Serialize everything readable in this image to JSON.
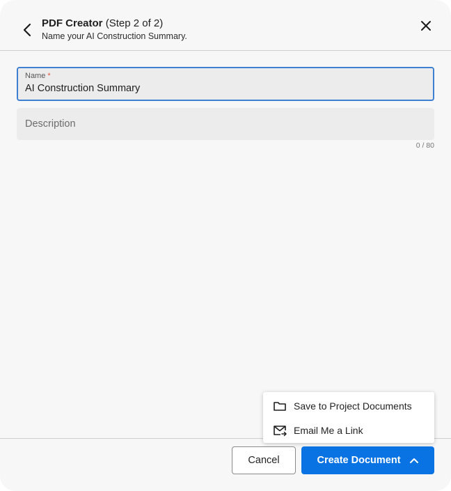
{
  "dialog": {
    "title": "PDF Creator",
    "step": "(Step 2 of 2)",
    "subtitle": "Name your AI Construction Summary."
  },
  "form": {
    "name_label": "Name",
    "required_marker": "*",
    "name_value": "AI Construction Summary",
    "description_placeholder": "Description",
    "description_value": "",
    "char_counter": "0 / 80"
  },
  "menu": {
    "items": [
      {
        "label": "Save to Project Documents",
        "icon": "folder-icon"
      },
      {
        "label": "Email Me a Link",
        "icon": "email-forward-icon"
      }
    ]
  },
  "footer": {
    "cancel_label": "Cancel",
    "create_label": "Create Document"
  },
  "colors": {
    "accent": "#0a73e3",
    "focus_border": "#3d7fd0",
    "required": "#e0533c"
  }
}
